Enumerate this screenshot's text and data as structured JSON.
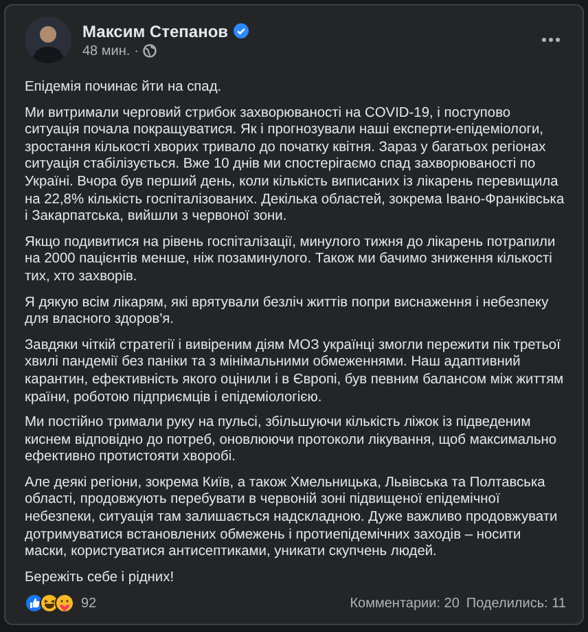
{
  "post": {
    "author": "Максим Степанов",
    "verified": true,
    "time": "48 мин.",
    "separator": "·",
    "paragraphs": [
      "Епідемія починає йти на спад.",
      "Ми витримали черговий стрибок захворюваності на COVID-19, і поступово ситуація почала покращуватися. Як і прогнозували наші експерти-епідеміологи, зростання кількості хворих тривало до початку квітня. Зараз у багатьох регіонах ситуація стабілізується. Вже 10 днів ми спостерігаємо спад захворюваності по Україні. Вчора був перший день, коли кількість виписаних із лікарень перевищила на 22,8% кількість госпіталізованих. Декілька областей, зокрема Івано-Франківська і Закарпатська, вийшли з червоної зони.",
      "Якщо подивитися на рівень госпіталізації, минулого тижня до лікарень потрапили на 2000 пацієнтів менше, ніж позаминулого. Також ми бачимо зниження кількості тих, хто захворів.",
      "Я дякую всім лікарям, які врятували безліч життів попри виснаження і небезпеку для власного здоров'я.",
      "Завдяки чіткій стратегії і вивіреним діям МОЗ українці змогли пережити пік третьої хвилі пандемії без паніки та з мінімальними обмеженнями. Наш адаптивний карантин, ефективність якого оцінили і в Європі, був певним балансом між життям країни, роботою підприємців і епідеміологією.",
      "Ми постійно тримали руку на пульсі, збільшуючи кількість ліжок із підведеним киснем відповідно до потреб, оновлюючи протоколи лікування, щоб максимально ефективно протистояти хворобі.",
      "Але деякі регіони, зокрема Київ, а також Хмельницька, Львівська та Полтавська області, продовжують перебувати в червоній зоні підвищеної епідемічної небезпеки, ситуація там залишається надскладною. Дуже важливо продовжувати дотримуватися встановлених обмежень і протиепідемічних заходів – носити маски, користуватися антисептиками, уникати скупчень людей.",
      "Бережіть себе і рідних!"
    ],
    "reactions": [
      {
        "kind": "like"
      },
      {
        "kind": "haha"
      },
      {
        "kind": "care"
      }
    ],
    "reaction_count": "92",
    "comments": "Комментарии: 20",
    "shares": "Поделились: 11"
  }
}
